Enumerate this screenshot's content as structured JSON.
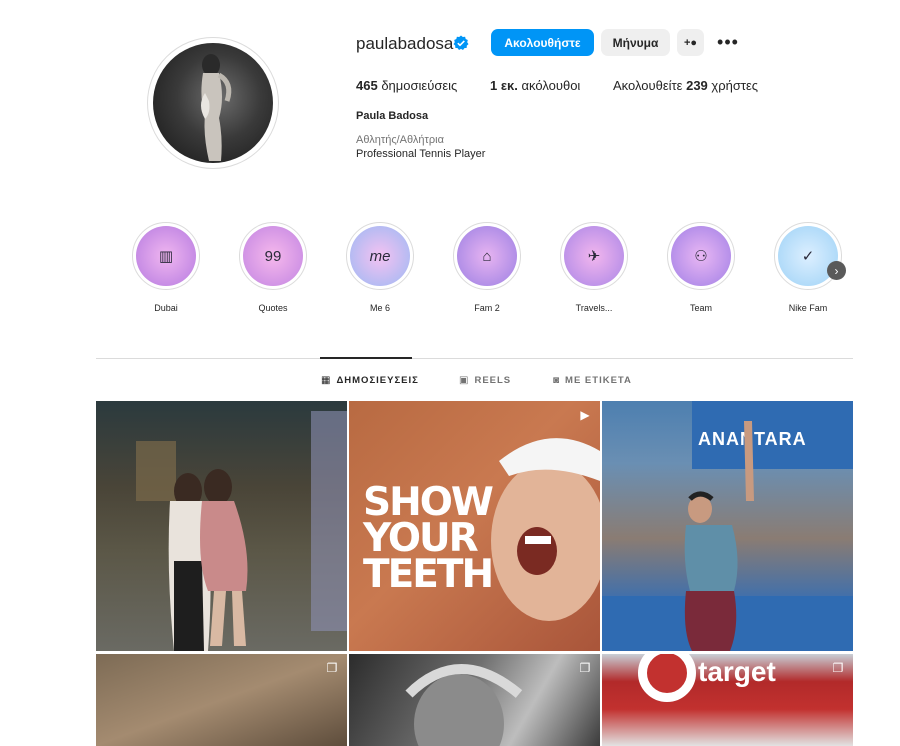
{
  "profile": {
    "username": "paulabadosa",
    "follow_label": "Ακολουθήστε",
    "message_label": "Μήνυμα",
    "suggest_icon": "add-user-icon",
    "more_icon": "more-dots-icon",
    "stats": {
      "posts_count": "465",
      "posts_label": " δημοσιεύσεις",
      "followers_count": "1 εκ.",
      "followers_label": " ακόλουθοι",
      "following_prefix": "Ακολουθείτε ",
      "following_count": "239",
      "following_label": " χρήστες"
    },
    "full_name": "Paula Badosa",
    "category": "Αθλητής/Αθλήτρια",
    "bio": "Professional Tennis Player"
  },
  "highlights": [
    {
      "label": "Dubai",
      "icon": "skyline-icon",
      "glyph": "▥"
    },
    {
      "label": "Quotes",
      "icon": "quote-icon",
      "glyph": "99"
    },
    {
      "label": "Me 6",
      "icon": "signature-icon",
      "glyph": "me"
    },
    {
      "label": "Fam 2",
      "icon": "home-icon",
      "glyph": "⌂"
    },
    {
      "label": "Travels...",
      "icon": "airplane-icon",
      "glyph": "✈"
    },
    {
      "label": "Team",
      "icon": "group-icon",
      "glyph": "⚇"
    },
    {
      "label": "Nike Fam",
      "icon": "nike-swoosh-icon",
      "glyph": "✓"
    }
  ],
  "tabs": [
    {
      "label": "ΔΗΜΟΣΙΕΥΣΕΙΣ",
      "icon": "grid-icon",
      "active": true
    },
    {
      "label": "REELS",
      "icon": "reels-icon",
      "active": false
    },
    {
      "label": "ΜΕ ΕΤΙΚΕΤΑ",
      "icon": "tagged-icon",
      "active": false
    }
  ],
  "posts": {
    "p2_text_line1": "SHOW",
    "p2_text_line2": "YOUR",
    "p2_text_line3": "TEETH",
    "p3_banner": "ANANTARA",
    "p6_text": "target"
  },
  "colors": {
    "accent": "#0095f6",
    "text": "#262626",
    "muted": "#737373",
    "border": "#dbdbdb"
  }
}
